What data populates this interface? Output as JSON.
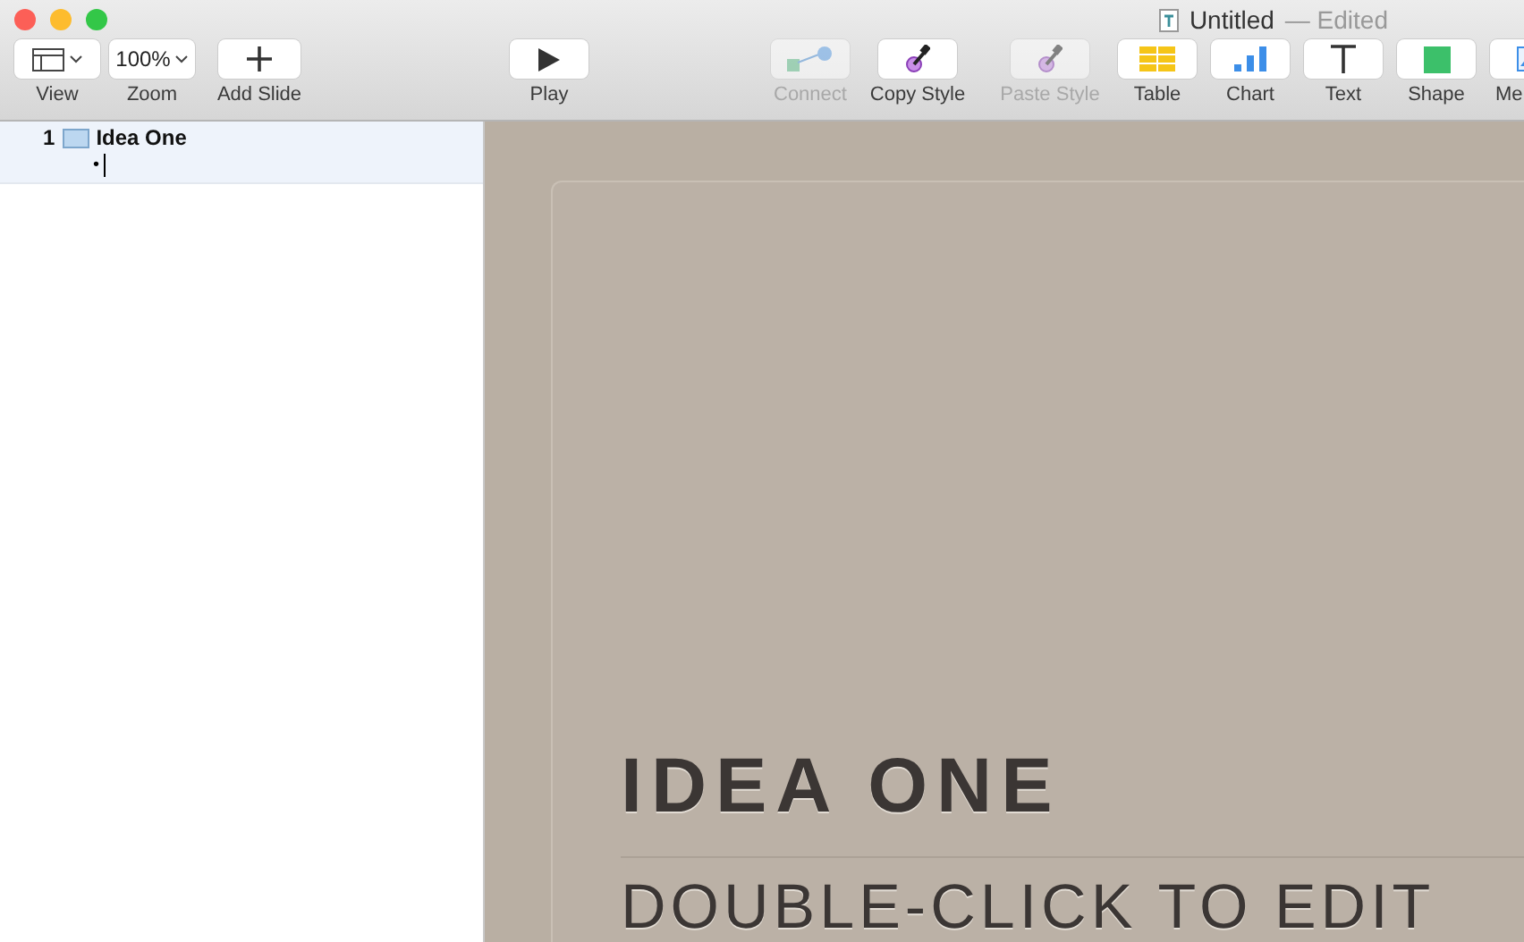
{
  "window": {
    "title": "Untitled",
    "status": "— Edited"
  },
  "toolbar": {
    "left": [
      {
        "label": "View",
        "kind": "view"
      },
      {
        "label": "Zoom",
        "kind": "zoom",
        "value": "100%"
      },
      {
        "label": "Add Slide",
        "kind": "add"
      }
    ],
    "center": [
      {
        "label": "Play",
        "kind": "play"
      }
    ],
    "right": [
      {
        "label": "Connect",
        "kind": "connect",
        "disabled": true
      },
      {
        "label": "Copy Style",
        "kind": "copy-style",
        "disabled": false
      },
      {
        "label": "Paste Style",
        "kind": "paste-style",
        "disabled": true
      },
      {
        "label": "Table",
        "kind": "table",
        "disabled": false
      },
      {
        "label": "Chart",
        "kind": "chart",
        "disabled": false
      },
      {
        "label": "Text",
        "kind": "text",
        "disabled": false
      },
      {
        "label": "Shape",
        "kind": "shape",
        "disabled": false
      },
      {
        "label": "Me",
        "kind": "media",
        "disabled": false
      }
    ]
  },
  "outline": [
    {
      "number": "1",
      "title": "Idea One",
      "selected": true,
      "bullet": "•"
    }
  ],
  "slide": {
    "title": "IDEA ONE",
    "subtitle": "DOUBLE-CLICK TO EDIT"
  }
}
